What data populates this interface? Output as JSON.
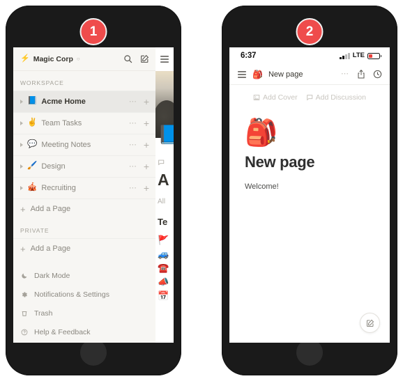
{
  "steps": [
    {
      "number": "1"
    },
    {
      "number": "2"
    }
  ],
  "phone1": {
    "sidebar": {
      "workspace": {
        "emoji": "⚡",
        "name": "Magic Corp",
        "switcher_icon": "switcher-icon"
      },
      "top_icons": [
        {
          "name": "search-icon"
        },
        {
          "name": "compose-icon"
        },
        {
          "name": "hamburger-menu-icon"
        }
      ],
      "sections": [
        {
          "label": "WORKSPACE",
          "pages": [
            {
              "emoji": "📘",
              "title": "Acme Home",
              "active": true
            },
            {
              "emoji": "✌️",
              "title": "Team Tasks",
              "active": false
            },
            {
              "emoji": "💬",
              "title": "Meeting Notes",
              "active": false
            },
            {
              "emoji": "🖌️",
              "title": "Design",
              "active": false
            },
            {
              "emoji": "🎪",
              "title": "Recruiting",
              "active": false
            }
          ],
          "add_page_label": "Add a Page"
        },
        {
          "label": "PRIVATE",
          "pages": [],
          "add_page_label": "Add a Page"
        }
      ],
      "utilities": [
        {
          "icon": "moon-icon",
          "label": "Dark Mode"
        },
        {
          "icon": "gear-icon",
          "label": "Notifications & Settings"
        },
        {
          "icon": "trash-icon",
          "label": "Trash"
        },
        {
          "icon": "help-icon",
          "label": "Help & Feedback"
        }
      ]
    },
    "peek_page": {
      "book_emoji": "📘",
      "title": "A",
      "subtitle": "All",
      "heading": "Te",
      "list_emojis": [
        "🚩",
        "🚙",
        "☎️",
        "📣",
        "📅"
      ]
    }
  },
  "phone2": {
    "statusbar": {
      "time": "6:37",
      "network": "LTE"
    },
    "navbar": {
      "menu_icon": "hamburger-menu-icon",
      "page_emoji": "🎒",
      "page_title": "New page",
      "right_icons": [
        {
          "name": "more-options-icon"
        },
        {
          "name": "share-icon"
        },
        {
          "name": "history-clock-icon"
        }
      ]
    },
    "page_actions": [
      {
        "icon": "image-icon",
        "label": "Add Cover"
      },
      {
        "icon": "comment-icon",
        "label": "Add Discussion"
      }
    ],
    "content": {
      "icon": "🎒",
      "title": "New page",
      "body": "Welcome!"
    },
    "fab": {
      "name": "compose-fab",
      "icon": "compose-icon"
    }
  },
  "colors": {
    "badge": "#ef4c4c",
    "sidebar_bg": "#f7f6f3",
    "text_primary": "#37352f",
    "text_muted": "#8b8880"
  }
}
